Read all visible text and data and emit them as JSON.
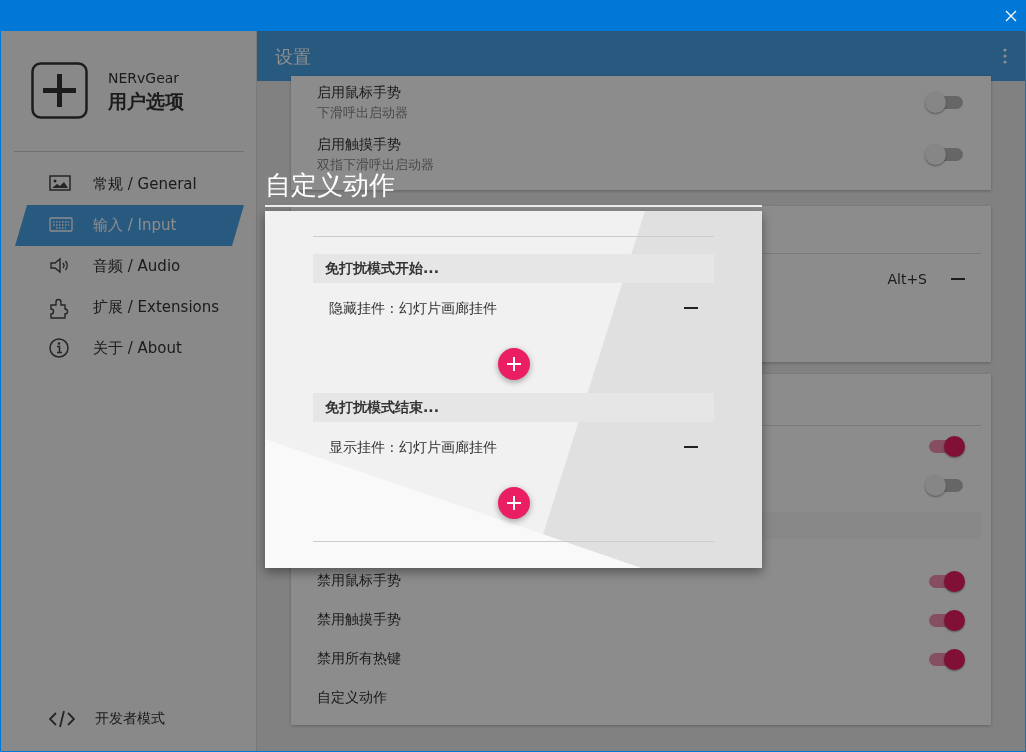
{
  "sidebar": {
    "app_name": "NERvGear",
    "title": "用户选项",
    "items": [
      {
        "label": "常规 / General",
        "selected": false
      },
      {
        "label": "输入 / Input",
        "selected": true
      },
      {
        "label": "音频 / Audio",
        "selected": false
      },
      {
        "label": "扩展 / Extensions",
        "selected": false
      },
      {
        "label": "关于 / About",
        "selected": false
      }
    ],
    "footer": {
      "label": "开发者模式"
    }
  },
  "app_bar": {
    "title": "设置"
  },
  "cards": [
    {
      "rows": [
        {
          "kind": "toggle",
          "label": "启用鼠标手势",
          "description": "下滑呼出启动器",
          "on": false
        },
        {
          "kind": "toggle",
          "label": "启用触摸手势",
          "description": "双指下滑呼出启动器",
          "on": false
        }
      ]
    },
    {
      "rows": [
        {
          "kind": "divider"
        },
        {
          "kind": "shortcut",
          "shortcut": "Alt+S"
        }
      ]
    },
    {
      "rows": [
        {
          "kind": "divider"
        },
        {
          "kind": "toggle",
          "on": true
        },
        {
          "kind": "toggle",
          "on": false
        },
        {
          "kind": "band"
        },
        {
          "kind": "toggle",
          "label": "禁用鼠标手势",
          "on": true
        },
        {
          "kind": "toggle",
          "label": "禁用触摸手势",
          "on": true
        },
        {
          "kind": "toggle",
          "label": "禁用所有热键",
          "on": true
        },
        {
          "kind": "link",
          "label": "自定义动作"
        }
      ]
    }
  ],
  "dialog": {
    "title": "自定义动作",
    "groups": [
      {
        "header": "免打扰模式开始...",
        "actions": [
          {
            "label": "隐藏挂件 : 幻灯片画廊挂件"
          }
        ]
      },
      {
        "header": "免打扰模式结束...",
        "actions": [
          {
            "label": "显示挂件 : 幻灯片画廊挂件"
          }
        ]
      }
    ]
  }
}
